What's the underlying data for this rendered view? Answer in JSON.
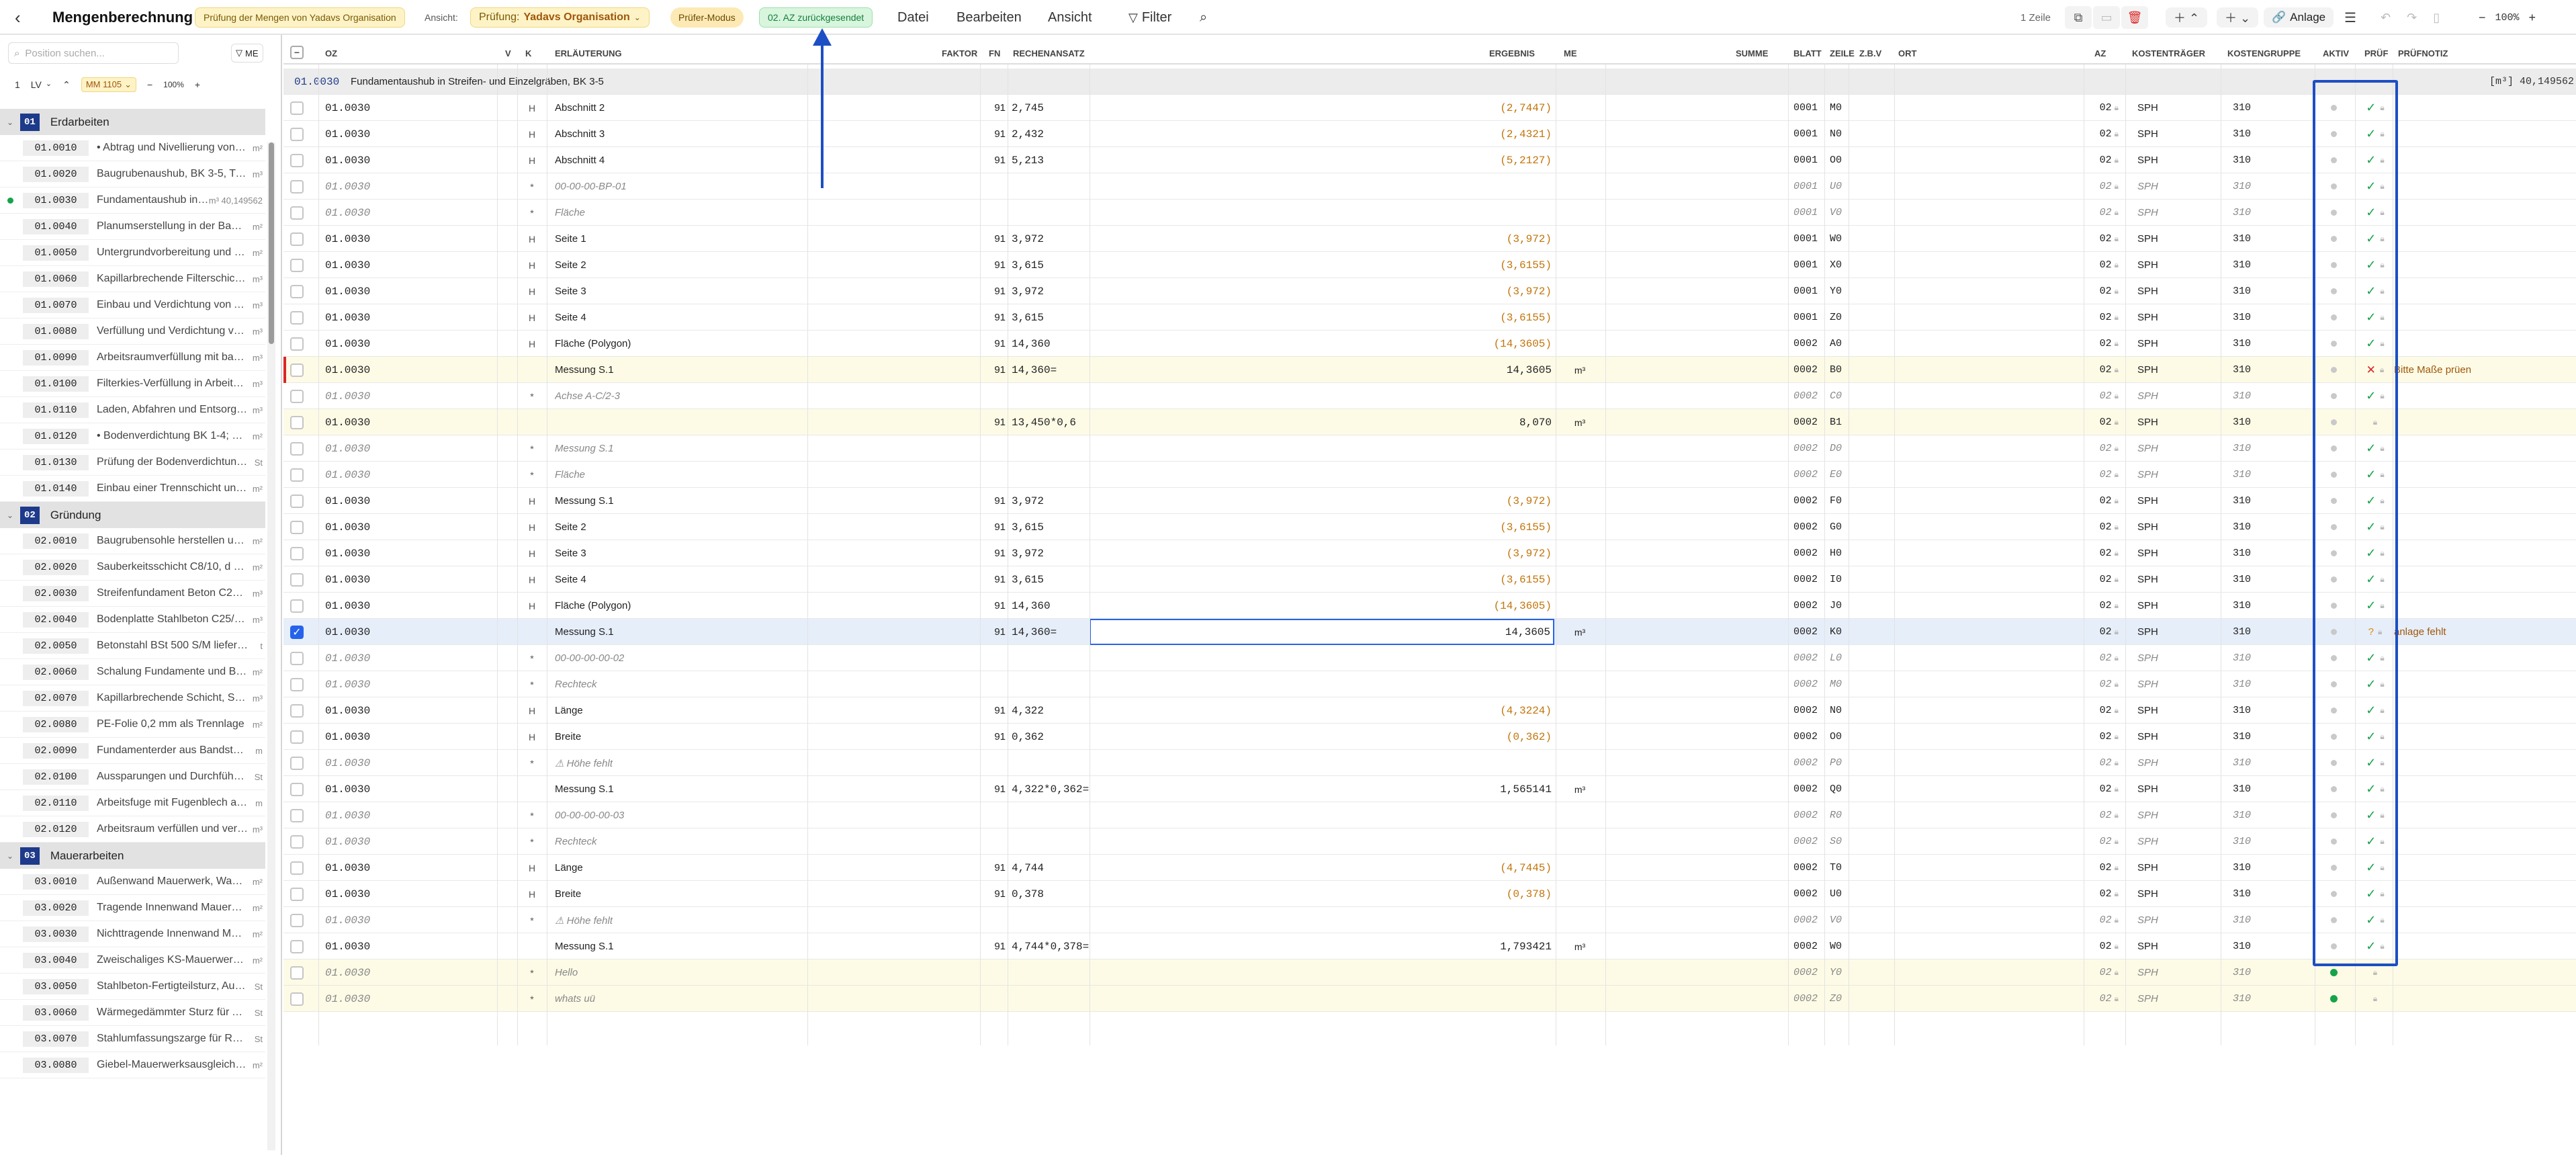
{
  "app": {
    "title": "Mengenberechnung",
    "badge_pruefung": "Prüfung der Mengen von Yadavs Organisation",
    "ansicht_label": "Ansicht:",
    "ansicht_value_prefix": "Prüfung:",
    "ansicht_value": "Yadavs Organisation",
    "mode_badge": "Prüfer-Modus",
    "status_badge": "02. AZ zurückgesendet",
    "menu": [
      "Datei",
      "Bearbeiten",
      "Ansicht"
    ],
    "filter": "Filter",
    "zeile": "1 Zeile",
    "anlage": "Anlage",
    "zoom": "100%"
  },
  "sidebar": {
    "search_placeholder": "Position suchen...",
    "me": "ME",
    "lv_num": "1",
    "lv": "LV",
    "mm": "MM 1105",
    "zoom": "100%",
    "groups": [
      {
        "num": "01",
        "title": "Erdarbeiten",
        "items": [
          {
            "code": "01.0010",
            "text": "• Abtrag und Nivellierung von O...",
            "unit": "m²"
          },
          {
            "code": "01.0020",
            "text": "Baugrubenaushub, BK 3-5, Tiefe ...",
            "unit": "m³"
          },
          {
            "code": "01.0030",
            "text": "Fundamentaushub in ...",
            "unit": "m³ 40,149562",
            "active": true
          },
          {
            "code": "01.0040",
            "text": "Planumserstellung in der Baugru...",
            "unit": "m²"
          },
          {
            "code": "01.0050",
            "text": "Untergrundvorbereitung und Ver...",
            "unit": "m²"
          },
          {
            "code": "01.0060",
            "text": "Kapillarbrechende Filterschicht a...",
            "unit": "m³"
          },
          {
            "code": "01.0070",
            "text": "Einbau und Verdichtung von Auf...",
            "unit": "m³"
          },
          {
            "code": "01.0080",
            "text": "Verfüllung und Verdichtung von ...",
            "unit": "m³"
          },
          {
            "code": "01.0090",
            "text": "Arbeitsraumverfüllung mit bause...",
            "unit": "m³"
          },
          {
            "code": "01.0100",
            "text": "Filterkies-Verfüllung in Arbeitsrä...",
            "unit": "m³"
          },
          {
            "code": "01.0110",
            "text": "Laden, Abfahren und Entsorgen ...",
            "unit": "m³"
          },
          {
            "code": "01.0120",
            "text": "• Bodenverdichtung BK 1-4; Verk...",
            "unit": "m²"
          },
          {
            "code": "01.0130",
            "text": "Prüfung der Bodenverdichtung m...",
            "unit": "St"
          },
          {
            "code": "01.0140",
            "text": "Einbau einer Trennschicht unter ...",
            "unit": "m²"
          }
        ]
      },
      {
        "num": "02",
        "title": "Gründung",
        "items": [
          {
            "code": "02.0010",
            "text": "Baugrubensohle herstellen und v...",
            "unit": "m²"
          },
          {
            "code": "02.0020",
            "text": "Sauberkeitsschicht C8/10, d = 5 ...",
            "unit": "m²"
          },
          {
            "code": "02.0030",
            "text": "Streifenfundament Beton C25/30...",
            "unit": "m³"
          },
          {
            "code": "02.0040",
            "text": "Bodenplatte Stahlbeton C25/30, ...",
            "unit": "m³"
          },
          {
            "code": "02.0050",
            "text": "Betonstahl BSt 500 S/M liefern un...",
            "unit": "t"
          },
          {
            "code": "02.0060",
            "text": "Schalung Fundamente und Bode...",
            "unit": "m²"
          },
          {
            "code": "02.0070",
            "text": "Kapillarbrechende Schicht, Schot...",
            "unit": "m³"
          },
          {
            "code": "02.0080",
            "text": "PE-Folie 0,2 mm als Trennlage",
            "unit": "m²"
          },
          {
            "code": "02.0090",
            "text": "Fundamenterder aus Bandstahl 3...",
            "unit": "m"
          },
          {
            "code": "02.0100",
            "text": "Aussparungen und Durchführung...",
            "unit": "St"
          },
          {
            "code": "02.0110",
            "text": "Arbeitsfuge mit Fugenblech abdic...",
            "unit": "m"
          },
          {
            "code": "02.0120",
            "text": "Arbeitsraum verfüllen und verdic...",
            "unit": "m³"
          }
        ]
      },
      {
        "num": "03",
        "title": "Mauerarbeiten",
        "items": [
          {
            "code": "03.0010",
            "text": "Außenwand Mauerwerk, Wandst...",
            "unit": "m²"
          },
          {
            "code": "03.0020",
            "text": "Tragende Innenwand Mauerwerk...",
            "unit": "m²"
          },
          {
            "code": "03.0030",
            "text": "Nichttragende Innenwand Maue...",
            "unit": "m²"
          },
          {
            "code": "03.0040",
            "text": "Zweischaliges KS-Mauerwerk im ...",
            "unit": "m²"
          },
          {
            "code": "03.0050",
            "text": "Stahlbeton-Fertigteilsturz, Auflag...",
            "unit": "St"
          },
          {
            "code": "03.0060",
            "text": "Wärmegedämmter Sturz für Auße...",
            "unit": "St"
          },
          {
            "code": "03.0070",
            "text": "Stahlumfassungszarge für Rohba...",
            "unit": "St"
          },
          {
            "code": "03.0080",
            "text": "Giebel-Mauerwerksausgleich mit ...",
            "unit": "m²"
          }
        ]
      }
    ]
  },
  "columns": [
    "OZ",
    "V",
    "K",
    "ERLÄUTERUNG",
    "FAKTOR",
    "FN",
    "RECHENANSATZ",
    "ERGEBNIS",
    "ME",
    "SUMME",
    "BLATT",
    "ZEILE",
    "Z.B.V",
    "ORT",
    "AZ",
    "KOSTENTRÄGER",
    "KOSTENGRUPPE",
    "AKTIV",
    "PRÜF",
    "PRÜFNOTIZ"
  ],
  "section": {
    "code": "01.0030",
    "title": "Fundamentaushub in Streifen- und Einzelgräben, BK 3-5",
    "total": "[m³] 40,149562"
  },
  "rows": [
    {
      "oz": "01.0030",
      "k": "H",
      "erl": "Abschnitt 2",
      "fn": "91",
      "ra": "2,745",
      "erg": "(2,7447)",
      "blatt": "0001",
      "zeile": "M0",
      "az": "02",
      "kt": "SPH",
      "kg": "310",
      "pruef": "ok"
    },
    {
      "oz": "01.0030",
      "k": "H",
      "erl": "Abschnitt 3",
      "fn": "91",
      "ra": "2,432",
      "erg": "(2,4321)",
      "blatt": "0001",
      "zeile": "N0",
      "az": "02",
      "kt": "SPH",
      "kg": "310",
      "pruef": "ok"
    },
    {
      "oz": "01.0030",
      "k": "H",
      "erl": "Abschnitt 4",
      "fn": "91",
      "ra": "5,213",
      "erg": "(5,2127)",
      "blatt": "0001",
      "zeile": "O0",
      "az": "02",
      "kt": "SPH",
      "kg": "310",
      "pruef": "ok"
    },
    {
      "oz": "01.0030",
      "k": "*",
      "erl": "00-00-00-BP-01",
      "fn": "",
      "ra": "",
      "erg": "",
      "blatt": "0001",
      "zeile": "U0",
      "az": "02",
      "kt": "SPH",
      "kg": "310",
      "pruef": "ok",
      "it": true
    },
    {
      "oz": "01.0030",
      "k": "*",
      "erl": "Fläche",
      "fn": "",
      "ra": "",
      "erg": "",
      "blatt": "0001",
      "zeile": "V0",
      "az": "02",
      "kt": "SPH",
      "kg": "310",
      "pruef": "ok",
      "it": true
    },
    {
      "oz": "01.0030",
      "k": "H",
      "erl": "Seite 1",
      "fn": "91",
      "ra": "3,972",
      "erg": "(3,972)",
      "blatt": "0001",
      "zeile": "W0",
      "az": "02",
      "kt": "SPH",
      "kg": "310",
      "pruef": "ok"
    },
    {
      "oz": "01.0030",
      "k": "H",
      "erl": "Seite 2",
      "fn": "91",
      "ra": "3,615",
      "erg": "(3,6155)",
      "blatt": "0001",
      "zeile": "X0",
      "az": "02",
      "kt": "SPH",
      "kg": "310",
      "pruef": "ok"
    },
    {
      "oz": "01.0030",
      "k": "H",
      "erl": "Seite 3",
      "fn": "91",
      "ra": "3,972",
      "erg": "(3,972)",
      "blatt": "0001",
      "zeile": "Y0",
      "az": "02",
      "kt": "SPH",
      "kg": "310",
      "pruef": "ok"
    },
    {
      "oz": "01.0030",
      "k": "H",
      "erl": "Seite 4",
      "fn": "91",
      "ra": "3,615",
      "erg": "(3,6155)",
      "blatt": "0001",
      "zeile": "Z0",
      "az": "02",
      "kt": "SPH",
      "kg": "310",
      "pruef": "ok"
    },
    {
      "oz": "01.0030",
      "k": "H",
      "erl": "Fläche (Polygon)",
      "fn": "91",
      "ra": "14,360",
      "erg": "(14,3605)",
      "blatt": "0002",
      "zeile": "A0",
      "az": "02",
      "kt": "SPH",
      "kg": "310",
      "pruef": "ok"
    },
    {
      "oz": "01.0030",
      "k": "",
      "erl": "Messung S.1",
      "fn": "91",
      "ra": "14,360=",
      "erg": "14,3605",
      "me": "m³",
      "blatt": "0002",
      "zeile": "B0",
      "az": "02",
      "kt": "SPH",
      "kg": "310",
      "pruef": "x",
      "note": "Bitte Maße prüen",
      "yellow": true,
      "flag": true
    },
    {
      "oz": "01.0030",
      "k": "*",
      "erl": "Achse A-C/2-3",
      "fn": "",
      "ra": "",
      "erg": "",
      "blatt": "0002",
      "zeile": "C0",
      "az": "02",
      "kt": "SPH",
      "kg": "310",
      "pruef": "ok",
      "it": true
    },
    {
      "oz": "01.0030",
      "k": "",
      "erl": "",
      "fn": "91",
      "ra": "13,450*0,6",
      "erg": "8,070",
      "me": "m³",
      "blatt": "0002",
      "zeile": "B1",
      "az": "02",
      "kt": "SPH",
      "kg": "310",
      "pruef": "none",
      "yellow": true
    },
    {
      "oz": "01.0030",
      "k": "*",
      "erl": "Messung S.1",
      "fn": "",
      "ra": "",
      "erg": "",
      "blatt": "0002",
      "zeile": "D0",
      "az": "02",
      "kt": "SPH",
      "kg": "310",
      "pruef": "ok",
      "it": true
    },
    {
      "oz": "01.0030",
      "k": "*",
      "erl": "Fläche",
      "fn": "",
      "ra": "",
      "erg": "",
      "blatt": "0002",
      "zeile": "E0",
      "az": "02",
      "kt": "SPH",
      "kg": "310",
      "pruef": "ok",
      "it": true
    },
    {
      "oz": "01.0030",
      "k": "H",
      "erl": "Messung S.1",
      "fn": "91",
      "ra": "3,972",
      "erg": "(3,972)",
      "blatt": "0002",
      "zeile": "F0",
      "az": "02",
      "kt": "SPH",
      "kg": "310",
      "pruef": "ok"
    },
    {
      "oz": "01.0030",
      "k": "H",
      "erl": "Seite 2",
      "fn": "91",
      "ra": "3,615",
      "erg": "(3,6155)",
      "blatt": "0002",
      "zeile": "G0",
      "az": "02",
      "kt": "SPH",
      "kg": "310",
      "pruef": "ok"
    },
    {
      "oz": "01.0030",
      "k": "H",
      "erl": "Seite 3",
      "fn": "91",
      "ra": "3,972",
      "erg": "(3,972)",
      "blatt": "0002",
      "zeile": "H0",
      "az": "02",
      "kt": "SPH",
      "kg": "310",
      "pruef": "ok"
    },
    {
      "oz": "01.0030",
      "k": "H",
      "erl": "Seite 4",
      "fn": "91",
      "ra": "3,615",
      "erg": "(3,6155)",
      "blatt": "0002",
      "zeile": "I0",
      "az": "02",
      "kt": "SPH",
      "kg": "310",
      "pruef": "ok"
    },
    {
      "oz": "01.0030",
      "k": "H",
      "erl": "Fläche (Polygon)",
      "fn": "91",
      "ra": "14,360",
      "erg": "(14,3605)",
      "blatt": "0002",
      "zeile": "J0",
      "az": "02",
      "kt": "SPH",
      "kg": "310",
      "pruef": "ok"
    },
    {
      "oz": "01.0030",
      "k": "",
      "erl": "Messung S.1",
      "fn": "91",
      "ra": "14,360=",
      "erg": "14,3605",
      "me": "m³",
      "blatt": "0002",
      "zeile": "K0",
      "az": "02",
      "kt": "SPH",
      "kg": "310",
      "pruef": "q",
      "note": "anlage fehlt",
      "selected": true
    },
    {
      "oz": "01.0030",
      "k": "*",
      "erl": "00-00-00-00-02",
      "fn": "",
      "ra": "",
      "erg": "",
      "blatt": "0002",
      "zeile": "L0",
      "az": "02",
      "kt": "SPH",
      "kg": "310",
      "pruef": "ok",
      "it": true
    },
    {
      "oz": "01.0030",
      "k": "*",
      "erl": "Rechteck",
      "fn": "",
      "ra": "",
      "erg": "",
      "blatt": "0002",
      "zeile": "M0",
      "az": "02",
      "kt": "SPH",
      "kg": "310",
      "pruef": "ok",
      "it": true
    },
    {
      "oz": "01.0030",
      "k": "H",
      "erl": "Länge",
      "fn": "91",
      "ra": "4,322",
      "erg": "(4,3224)",
      "blatt": "0002",
      "zeile": "N0",
      "az": "02",
      "kt": "SPH",
      "kg": "310",
      "pruef": "ok"
    },
    {
      "oz": "01.0030",
      "k": "H",
      "erl": "Breite",
      "fn": "91",
      "ra": "0,362",
      "erg": "(0,362)",
      "blatt": "0002",
      "zeile": "O0",
      "az": "02",
      "kt": "SPH",
      "kg": "310",
      "pruef": "ok"
    },
    {
      "oz": "01.0030",
      "k": "*",
      "erl": "⚠ Höhe fehlt",
      "fn": "",
      "ra": "",
      "erg": "",
      "blatt": "0002",
      "zeile": "P0",
      "az": "02",
      "kt": "SPH",
      "kg": "310",
      "pruef": "ok",
      "it": true
    },
    {
      "oz": "01.0030",
      "k": "",
      "erl": "Messung S.1",
      "fn": "91",
      "ra": "4,322*0,362=",
      "erg": "1,565141",
      "me": "m³",
      "blatt": "0002",
      "zeile": "Q0",
      "az": "02",
      "kt": "SPH",
      "kg": "310",
      "pruef": "ok"
    },
    {
      "oz": "01.0030",
      "k": "*",
      "erl": "00-00-00-00-03",
      "fn": "",
      "ra": "",
      "erg": "",
      "blatt": "0002",
      "zeile": "R0",
      "az": "02",
      "kt": "SPH",
      "kg": "310",
      "pruef": "ok",
      "it": true
    },
    {
      "oz": "01.0030",
      "k": "*",
      "erl": "Rechteck",
      "fn": "",
      "ra": "",
      "erg": "",
      "blatt": "0002",
      "zeile": "S0",
      "az": "02",
      "kt": "SPH",
      "kg": "310",
      "pruef": "ok",
      "it": true
    },
    {
      "oz": "01.0030",
      "k": "H",
      "erl": "Länge",
      "fn": "91",
      "ra": "4,744",
      "erg": "(4,7445)",
      "blatt": "0002",
      "zeile": "T0",
      "az": "02",
      "kt": "SPH",
      "kg": "310",
      "pruef": "ok"
    },
    {
      "oz": "01.0030",
      "k": "H",
      "erl": "Breite",
      "fn": "91",
      "ra": "0,378",
      "erg": "(0,378)",
      "blatt": "0002",
      "zeile": "U0",
      "az": "02",
      "kt": "SPH",
      "kg": "310",
      "pruef": "ok"
    },
    {
      "oz": "01.0030",
      "k": "*",
      "erl": "⚠ Höhe fehlt",
      "fn": "",
      "ra": "",
      "erg": "",
      "blatt": "0002",
      "zeile": "V0",
      "az": "02",
      "kt": "SPH",
      "kg": "310",
      "pruef": "ok",
      "it": true
    },
    {
      "oz": "01.0030",
      "k": "",
      "erl": "Messung S.1",
      "fn": "91",
      "ra": "4,744*0,378=",
      "erg": "1,793421",
      "me": "m³",
      "blatt": "0002",
      "zeile": "W0",
      "az": "02",
      "kt": "SPH",
      "kg": "310",
      "pruef": "ok"
    },
    {
      "oz": "01.0030",
      "k": "*",
      "erl": "Hello",
      "fn": "",
      "ra": "",
      "erg": "",
      "blatt": "0002",
      "zeile": "Y0",
      "az": "02",
      "kt": "SPH",
      "kg": "310",
      "pruef": "none",
      "it": true,
      "yellow": true,
      "green": true
    },
    {
      "oz": "01.0030",
      "k": "*",
      "erl": "whats uü",
      "fn": "",
      "ra": "",
      "erg": "",
      "blatt": "0002",
      "zeile": "Z0",
      "az": "02",
      "kt": "SPH",
      "kg": "310",
      "pruef": "none",
      "it": true,
      "yellow": true,
      "green": true
    }
  ],
  "colors": {
    "accent": "#2563eb",
    "navy": "#1e3a8a",
    "orange": "#c2740a",
    "green": "#16a34a",
    "red": "#dc2626",
    "yellow_row": "#fdfbe6",
    "selected_row": "#e6eef9"
  }
}
